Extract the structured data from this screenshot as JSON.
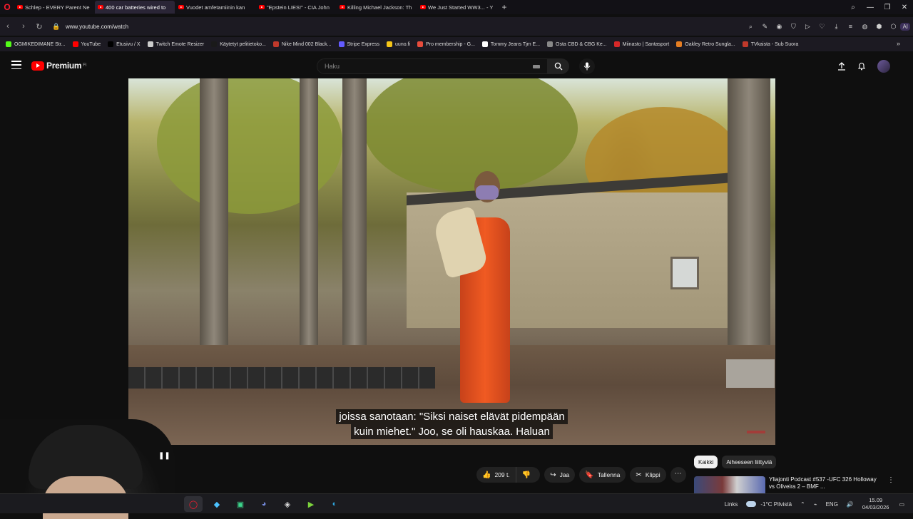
{
  "browser": {
    "tabs": [
      {
        "title": "Schlep - EVERY Parent Ne",
        "active": false
      },
      {
        "title": "400 car batteries wired to",
        "active": true
      },
      {
        "title": "Vuodet amfetamiinin kan",
        "active": false
      },
      {
        "title": "\"Epstein LIES!\" - CIA John",
        "active": false
      },
      {
        "title": "Killing Michael Jackson: Th",
        "active": false
      },
      {
        "title": "We Just Started WW3... - Y",
        "active": false
      }
    ],
    "url": "www.youtube.com/watch",
    "aria_label": "AI",
    "bookmarks": [
      {
        "label": "OGMIKEDIMANE Str...",
        "icon": "kick-icon",
        "color": "#53fc18"
      },
      {
        "label": "YouTube",
        "icon": "youtube-icon",
        "color": "#ff0000"
      },
      {
        "label": "Etusivu / X",
        "icon": "x-icon",
        "color": "#000000"
      },
      {
        "label": "Twitch Emote Resizer",
        "icon": "page-icon",
        "color": "#cccccc"
      },
      {
        "label": "Käytetyt pelitietoko...",
        "icon": "n-icon",
        "color": "#1a1a1a"
      },
      {
        "label": "Nike Mind 002 Black...",
        "icon": "nike-icon",
        "color": "#c0392b"
      },
      {
        "label": "Stripe Express",
        "icon": "stripe-icon",
        "color": "#635bff"
      },
      {
        "label": "uuno.fi",
        "icon": "uuno-icon",
        "color": "#f5c518"
      },
      {
        "label": "Pro membership - G...",
        "icon": "pin-icon",
        "color": "#e74c3c"
      },
      {
        "label": "Tommy Jeans Tjm E...",
        "icon": "tommy-icon",
        "color": "#ffffff"
      },
      {
        "label": "Osta CBD & CBG Ke...",
        "icon": "leaf-icon",
        "color": "#888888"
      },
      {
        "label": "Miinasto | Santasport",
        "icon": "santasport-icon",
        "color": "#d62828"
      },
      {
        "label": "Oakley Retro Sungla...",
        "icon": "oakley-icon",
        "color": "#e67e22"
      },
      {
        "label": "TVkaista - Sub Suora",
        "icon": "tv-icon",
        "color": "#c0392b"
      }
    ]
  },
  "youtube": {
    "logo_text": "Premium",
    "logo_region": "FI",
    "search_placeholder": "Haku",
    "subtitle_line1": "joissa sanotaan: \"Siksi naiset elävät pidempään",
    "subtitle_line2": "kuin miehet.\" Joo, se oli hauskaa.  Haluan",
    "like_count": "209 t.",
    "share_label": "Jaa",
    "save_label": "Tallenna",
    "clip_label": "Klippi",
    "chips": [
      "Kaikki",
      "Aiheeseen liittyviä"
    ],
    "recommendation_title": "Yliajonti Podcast #537 -UFC 326 Holloway vs Oliveira 2 – BMF ..."
  },
  "taskbar": {
    "links_label": "Links",
    "weather": "-1°C  Pilvistä",
    "language": "ENG",
    "time": "15.09",
    "date": "04/03/2026"
  }
}
